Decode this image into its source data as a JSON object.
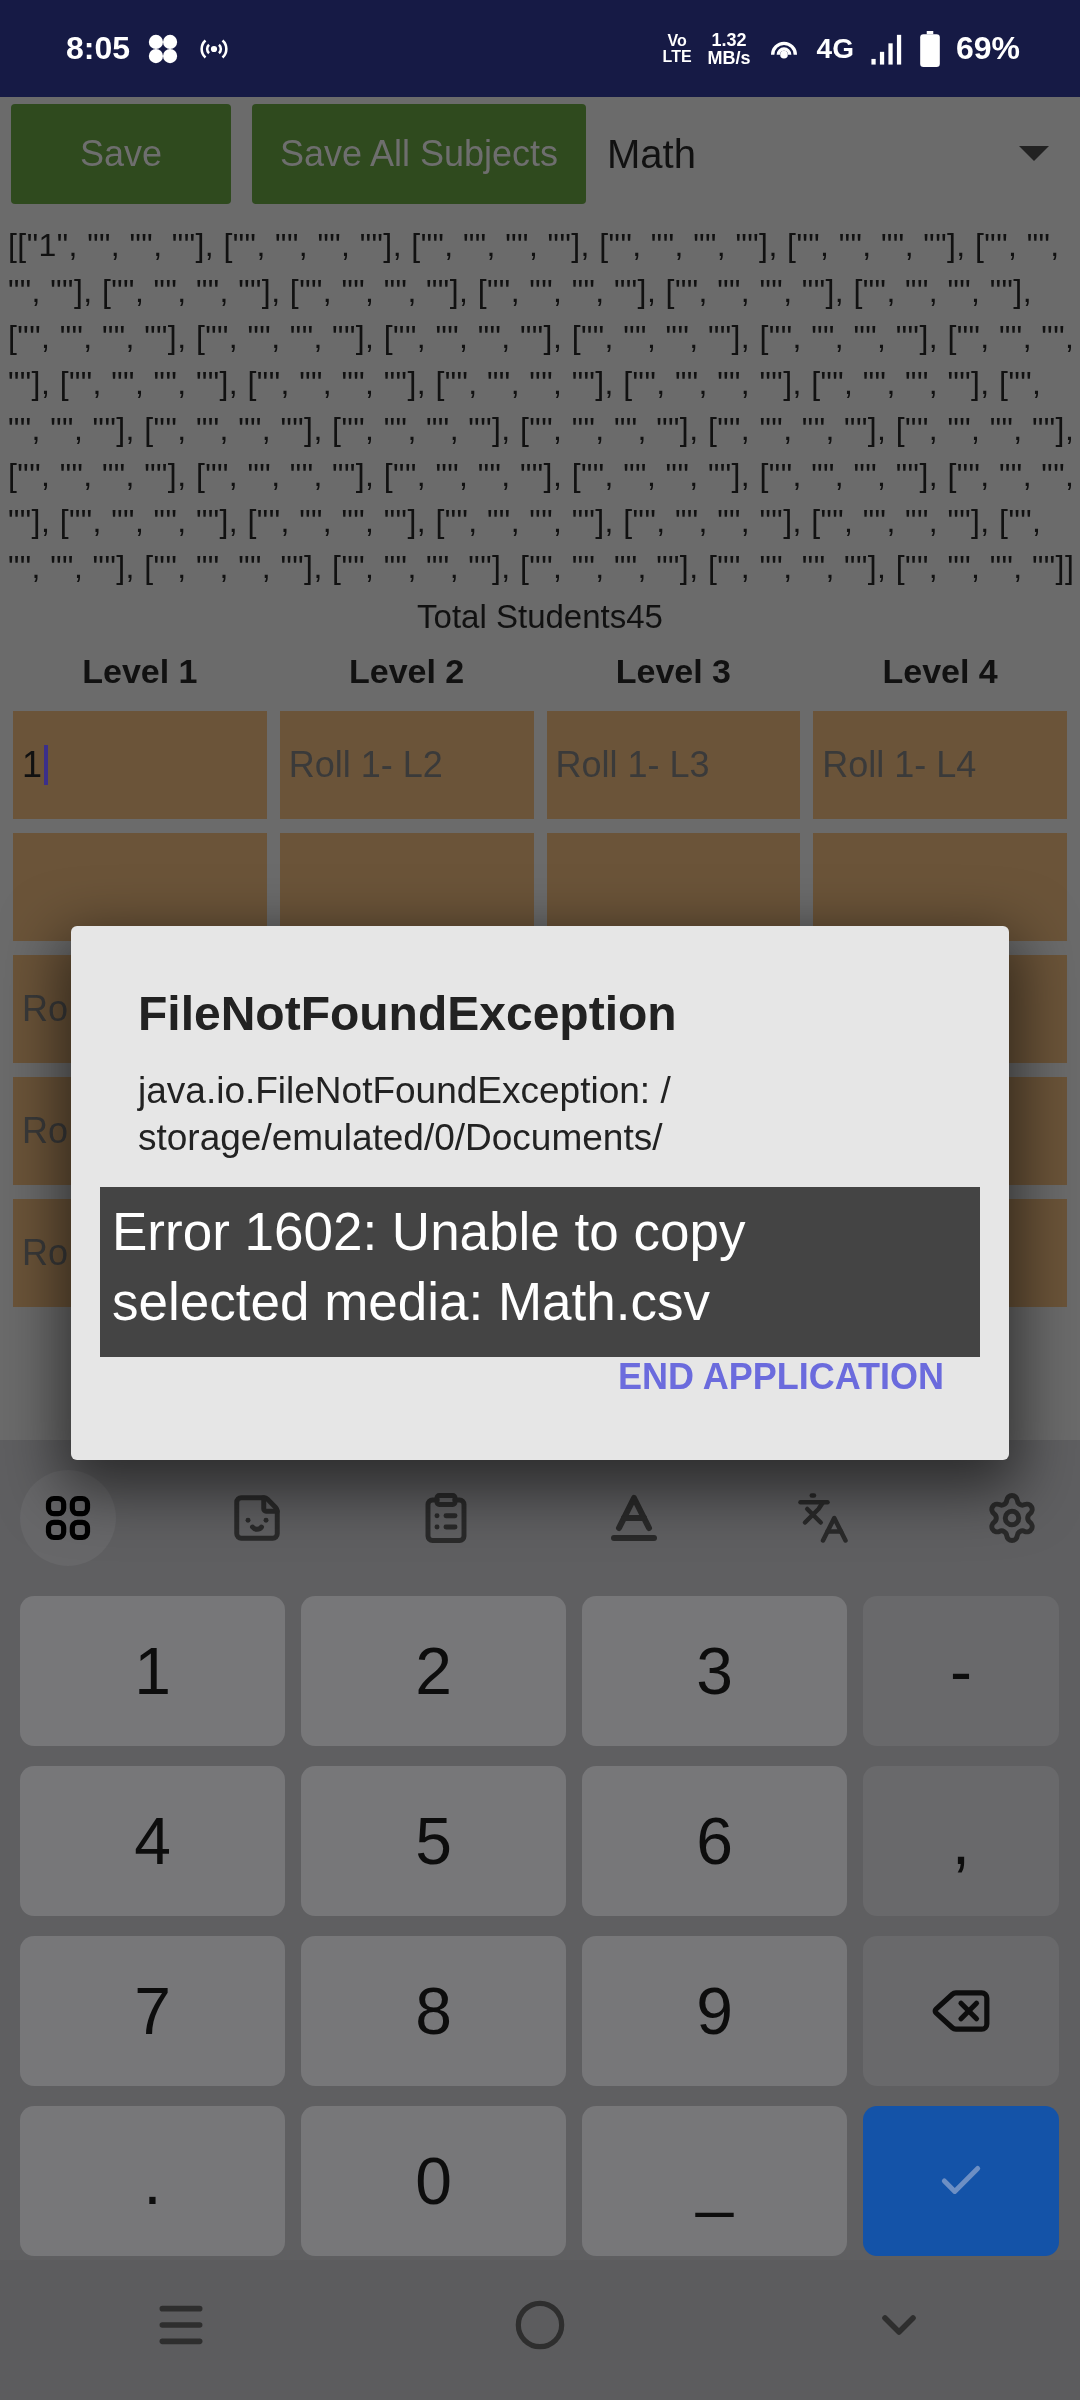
{
  "status_bar": {
    "time": "8:05",
    "volte_top": "Vo",
    "volte_bottom": "LTE",
    "speed_value": "1.32",
    "speed_unit": "MB/s",
    "network": "4G",
    "battery": "69%"
  },
  "toolbar": {
    "buttons": [
      {
        "label": "Save",
        "disabled": true
      },
      {
        "label": "Save All Subjects",
        "disabled": true
      }
    ],
    "subject_dropdown": {
      "value": "Math"
    }
  },
  "data_dump": "[[\"1\", \"\", \"\", \"\"], [\"\", \"\", \"\", \"\"], [\"\", \"\", \"\", \"\"], [\"\", \"\", \"\", \"\"], [\"\", \"\", \"\", \"\"], [\"\", \"\", \"\", \"\"], [\"\", \"\", \"\", \"\"], [\"\", \"\", \"\", \"\"], [\"\", \"\", \"\", \"\"], [\"\", \"\", \"\", \"\"], [\"\", \"\", \"\", \"\"], [\"\", \"\", \"\", \"\"], [\"\", \"\", \"\", \"\"], [\"\", \"\", \"\", \"\"], [\"\", \"\", \"\", \"\"], [\"\", \"\", \"\", \"\"], [\"\", \"\", \"\", \"\"], [\"\", \"\", \"\", \"\"], [\"\", \"\", \"\", \"\"], [\"\", \"\", \"\", \"\"], [\"\", \"\", \"\", \"\"], [\"\", \"\", \"\", \"\"], [\"\", \"\", \"\", \"\"], [\"\", \"\", \"\", \"\"], [\"\", \"\", \"\", \"\"], [\"\", \"\", \"\", \"\"], [\"\", \"\", \"\", \"\"], [\"\", \"\", \"\", \"\"], [\"\", \"\", \"\", \"\"], [\"\", \"\", \"\", \"\"], [\"\", \"\", \"\", \"\"], [\"\", \"\", \"\", \"\"], [\"\", \"\", \"\", \"\"], [\"\", \"\", \"\", \"\"], [\"\", \"\", \"\", \"\"], [\"\", \"\", \"\", \"\"], [\"\", \"\", \"\", \"\"], [\"\", \"\", \"\", \"\"], [\"\", \"\", \"\", \"\"], [\"\", \"\", \"\", \"\"], [\"\", \"\", \"\", \"\"], [\"\", \"\", \"\", \"\"], [\"\", \"\", \"\", \"\"], [\"\", \"\", \"\", \"\"], [\"\", \"\", \"\", \"\"]]",
  "total_students": "Total Students45",
  "table": {
    "columns": [
      "Level 1",
      "Level 2",
      "Level 3",
      "Level 4"
    ],
    "rows": [
      [
        {
          "value": "1",
          "focused": true
        },
        {
          "placeholder": "Roll 1- L2",
          "focused": false
        },
        {
          "placeholder": "Roll 1- L3",
          "focused": false
        },
        {
          "placeholder": "Roll 1- L4",
          "focused": false
        }
      ],
      [
        {
          "focused": false
        },
        {
          "focused": false
        },
        {
          "focused": false
        },
        {
          "focused": false
        }
      ],
      [
        {
          "placeholder": "Ro",
          "focused": false
        }
      ],
      [
        {
          "placeholder": "Ro",
          "focused": false
        }
      ],
      [
        {
          "placeholder": "Ro",
          "focused": false
        }
      ]
    ]
  },
  "dialog": {
    "title": "FileNotFoundException",
    "message_lines": [
      "java.io.FileNotFoundException: /",
      "storage/emulated/0/Documents/"
    ],
    "button": "END APPLICATION"
  },
  "toast": {
    "text": "Error 1602: Unable to copy selected media: Math.csv"
  },
  "keyboard": {
    "tools": [
      {
        "kind": "grid",
        "selected": true
      },
      {
        "kind": "sticker",
        "selected": false
      },
      {
        "kind": "clipboard",
        "selected": false
      },
      {
        "kind": "font",
        "selected": false
      },
      {
        "kind": "translate",
        "selected": false
      },
      {
        "kind": "settings",
        "selected": false
      }
    ],
    "rows": [
      [
        {
          "kind": "digit",
          "label": "1"
        },
        {
          "kind": "digit",
          "label": "2"
        },
        {
          "kind": "digit",
          "label": "3"
        },
        {
          "kind": "symbol",
          "label": "-"
        }
      ],
      [
        {
          "kind": "digit",
          "label": "4"
        },
        {
          "kind": "digit",
          "label": "5"
        },
        {
          "kind": "digit",
          "label": "6"
        },
        {
          "kind": "symbol",
          "label": ","
        }
      ],
      [
        {
          "kind": "digit",
          "label": "7"
        },
        {
          "kind": "digit",
          "label": "8"
        },
        {
          "kind": "digit",
          "label": "9"
        },
        {
          "kind": "backspace"
        }
      ],
      [
        {
          "kind": "digit",
          "label": "."
        },
        {
          "kind": "digit",
          "label": "0"
        },
        {
          "kind": "digit",
          "label": "_"
        },
        {
          "kind": "enter"
        }
      ]
    ]
  }
}
